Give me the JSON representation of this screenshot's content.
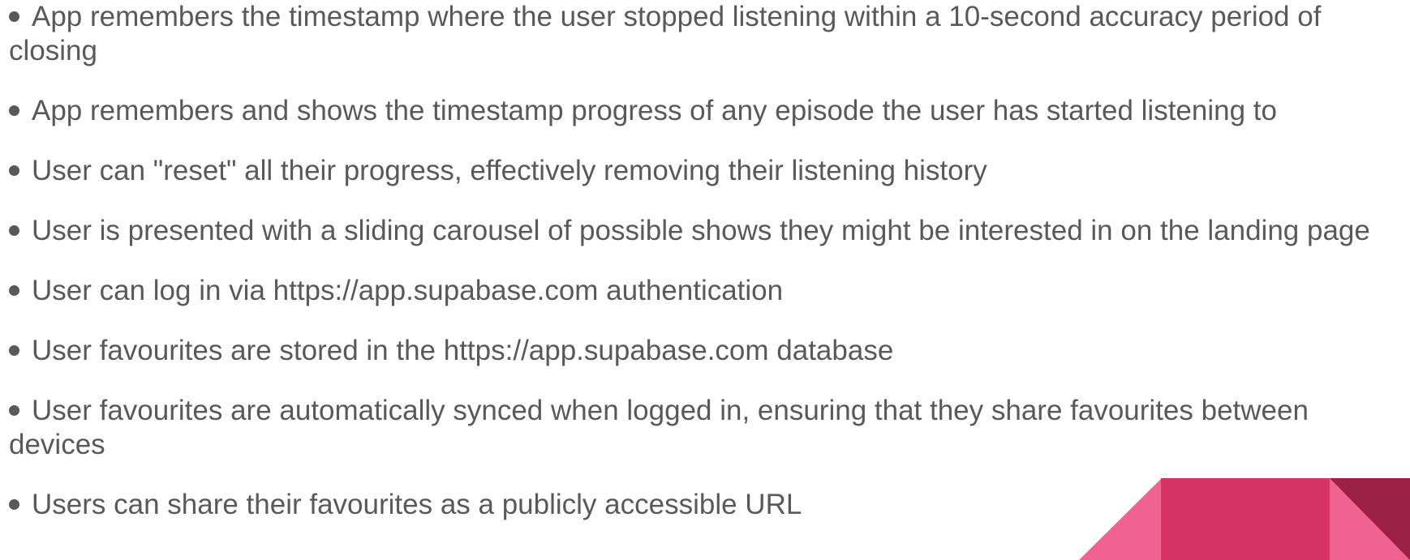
{
  "slide": {
    "bullets": [
      "App remembers the timestamp where the user stopped listening within a 10-second accuracy period of closing",
      "App remembers and shows the timestamp progress of any episode the user has started listening to",
      "User can \"reset\" all their progress, effectively removing their listening history",
      "User is presented with a sliding carousel of possible shows they might be interested in on the landing page",
      "User can log in via https://app.supabase.com authentication",
      "User favourites are stored in the https://app.supabase.com database",
      "User favourites are automatically synced when logged in, ensuring that they share favourites between devices",
      "Users can share their favourites as a publicly accessible URL"
    ]
  },
  "colors": {
    "text": "#595959",
    "decor_light_pink": "#f06292",
    "decor_magenta": "#d63369",
    "decor_dark_maroon": "#9c2146"
  }
}
